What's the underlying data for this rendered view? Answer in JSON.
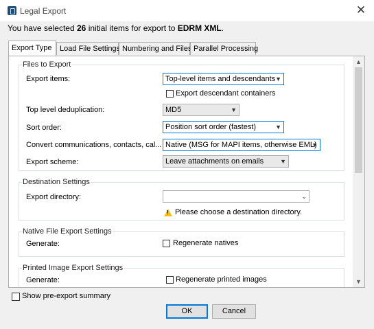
{
  "window": {
    "title": "Legal Export",
    "close_icon": "close-icon"
  },
  "selection": {
    "prefix": "You have selected",
    "count": "26",
    "middle": "initial items for export to",
    "target": "EDRM XML",
    "suffix": "."
  },
  "tabs": [
    {
      "label": "Export Type",
      "active": true
    },
    {
      "label": "Load File Settings"
    },
    {
      "label": "Numbering and Files"
    },
    {
      "label": "Parallel Processing"
    }
  ],
  "files_to_export": {
    "legend": "Files to Export",
    "export_items": {
      "label": "Export items:",
      "value": "Top-level items and descendants"
    },
    "export_descendant_containers": {
      "label": "Export descendant containers",
      "checked": false
    },
    "top_level_dedup": {
      "label": "Top level deduplication:",
      "value": "MD5"
    },
    "sort_order": {
      "label": "Sort order:",
      "value": "Position sort order (fastest)"
    },
    "convert": {
      "label": "Convert communications, contacts, cal...",
      "value": "Native (MSG for MAPI items, otherwise EML)"
    },
    "export_scheme": {
      "label": "Export scheme:",
      "value": "Leave attachments on emails"
    }
  },
  "destination": {
    "legend": "Destination Settings",
    "directory_label": "Export directory:",
    "directory_value": "",
    "warning": "Please choose a destination directory."
  },
  "native": {
    "legend": "Native File Export Settings",
    "generate_label": "Generate:",
    "regenerate_label": "Regenerate natives",
    "checked": false
  },
  "printed": {
    "legend": "Printed Image Export Settings",
    "generate_label": "Generate:",
    "regenerate_label": "Regenerate printed images",
    "checked": false
  },
  "footer": {
    "show_summary_label": "Show pre-export summary",
    "show_summary_checked": false,
    "ok_label": "OK",
    "cancel_label": "Cancel"
  }
}
